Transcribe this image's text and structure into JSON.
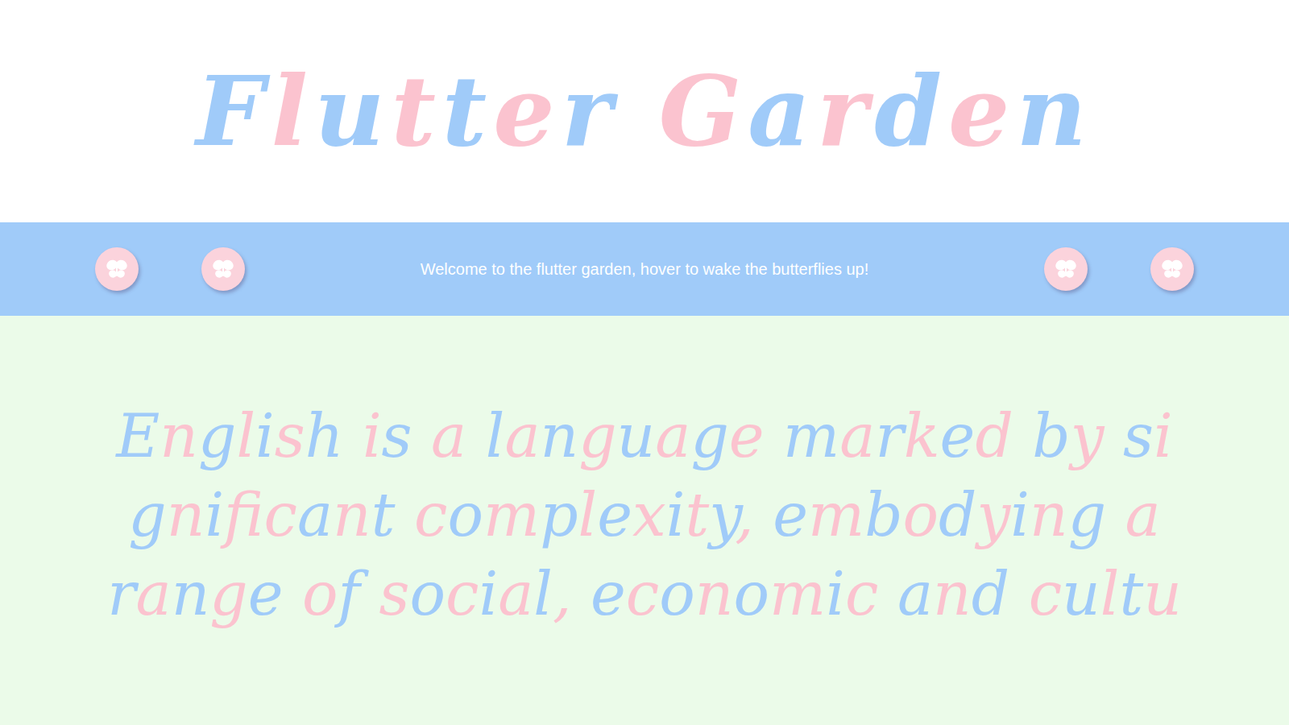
{
  "header": {
    "title": "Flutter Garden"
  },
  "banner": {
    "message": "Welcome to the flutter garden, hover to wake the butterflies up!"
  },
  "body": {
    "text": "English is a language marked by significant complexity, embodying a range of social, economic and cultu"
  }
}
